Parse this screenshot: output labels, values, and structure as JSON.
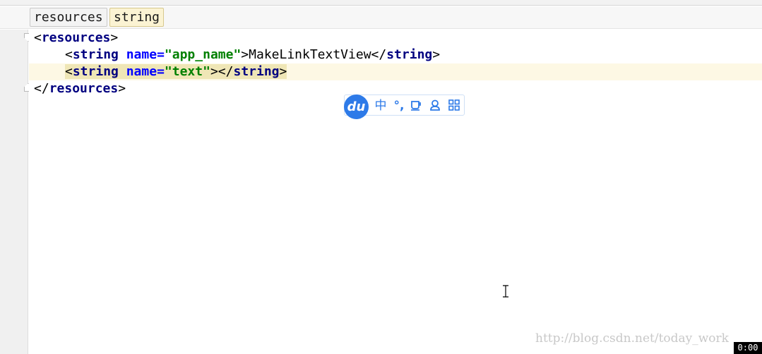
{
  "breadcrumb": [
    "resources",
    "string"
  ],
  "code": {
    "line1": {
      "open": "<",
      "tag": "resources",
      "close": ">"
    },
    "line2": {
      "open": "<",
      "tag": "string",
      "space": " ",
      "attr": "name",
      "eq": "=",
      "value": "\"app_name\"",
      "gt": ">",
      "text": "MakeLinkTextView",
      "end_open": "</",
      "end_tag": "string",
      "end_close": ">"
    },
    "line3": {
      "open": "<",
      "tag": "string",
      "space": " ",
      "attr": "name",
      "eq": "=",
      "value": "\"text\"",
      "gt": ">",
      "end_open": "</",
      "end_tag": "string",
      "end_close": ">"
    },
    "line4": {
      "open": "</",
      "tag": "resources",
      "close": ">"
    }
  },
  "ime_toolbar": {
    "logo": "du",
    "buttons": [
      "中",
      "°,"
    ],
    "icons": [
      "cup-icon",
      "user-icon",
      "grid-icon"
    ],
    "accent_color": "#2d7ae8"
  },
  "watermark": "http://blog.csdn.net/today_work",
  "timer": "0:00",
  "colors": {
    "tag": "#000080",
    "attr": "#0000ff",
    "value": "#008000",
    "current_line": "#fdf8e4",
    "active_crumb": "#fbf3d3"
  }
}
